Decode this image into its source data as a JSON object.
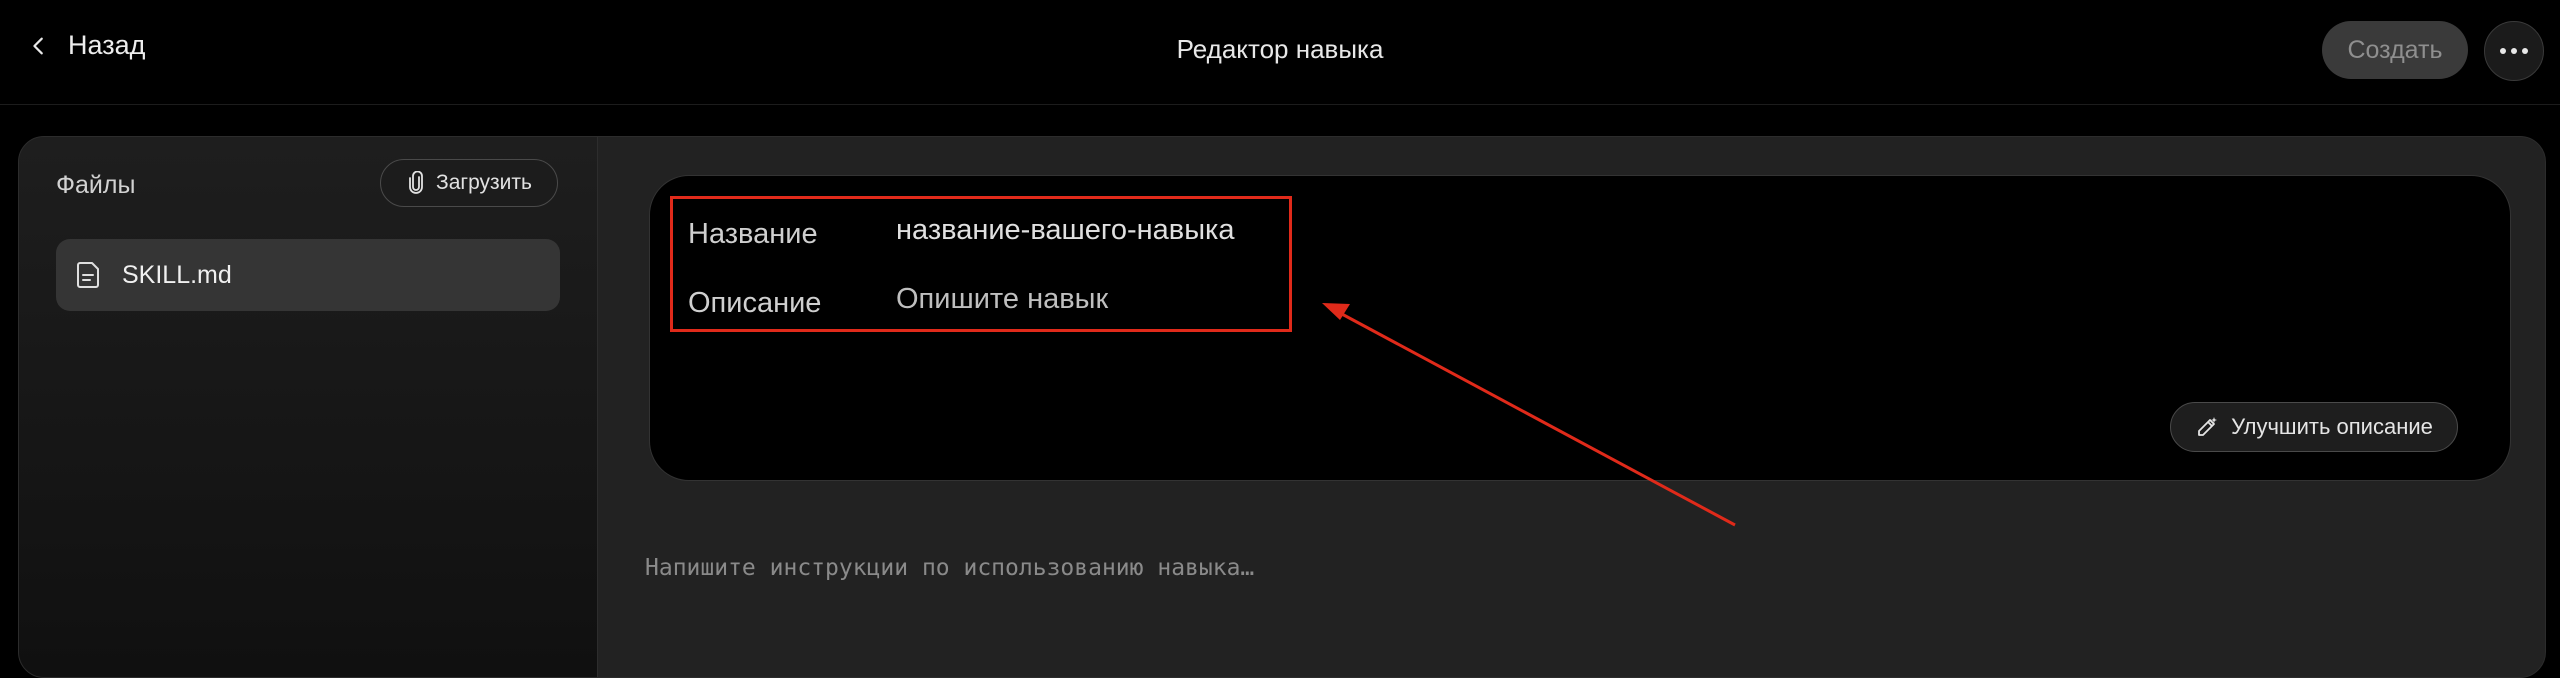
{
  "header": {
    "back_label": "Назад",
    "title": "Редактор навыка",
    "create_label": "Создать"
  },
  "sidebar": {
    "title": "Файлы",
    "upload_label": "Загрузить",
    "files": [
      {
        "name": "SKILL.md",
        "icon": "document-icon",
        "selected": true
      }
    ]
  },
  "frontmatter": {
    "name_label": "Название",
    "name_value": "название-вашего-навыка",
    "description_label": "Описание",
    "description_value": "Опишите навык",
    "improve_label": "Улучшить описание"
  },
  "editor": {
    "placeholder": "Напишите инструкции по использованию навыка…"
  },
  "annotation": {
    "color": "#e02a1a"
  }
}
